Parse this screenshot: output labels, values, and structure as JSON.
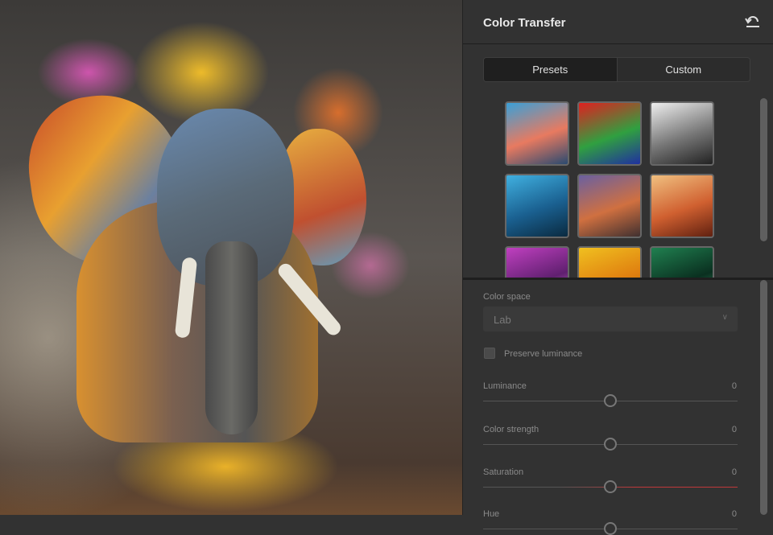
{
  "panel": {
    "title": "Color Transfer",
    "undo_icon": "undo-icon",
    "tabs": [
      {
        "label": "Presets",
        "active": true
      },
      {
        "label": "Custom",
        "active": false
      }
    ],
    "presets": [
      {
        "name": "sunset-sea",
        "colors": [
          "#3aa0d8",
          "#e87a60",
          "#2a4a70"
        ]
      },
      {
        "name": "abstract-paint",
        "colors": [
          "#e02020",
          "#30a040",
          "#2030a0"
        ]
      },
      {
        "name": "cathedral-bw",
        "colors": [
          "#eeeeee",
          "#777777",
          "#222222"
        ]
      },
      {
        "name": "blue-feathers",
        "colors": [
          "#40b0e0",
          "#1a6090",
          "#0a2a40"
        ]
      },
      {
        "name": "desert-road",
        "colors": [
          "#6a60a0",
          "#d07040",
          "#403030"
        ]
      },
      {
        "name": "skateboarder",
        "colors": [
          "#f0c080",
          "#d06030",
          "#602010"
        ]
      },
      {
        "name": "purple-flowers",
        "colors": [
          "#c040c0",
          "#602070",
          "#e080e0"
        ]
      },
      {
        "name": "yellow-flower",
        "colors": [
          "#f0c020",
          "#e08010",
          "#a06000"
        ]
      },
      {
        "name": "green-leaves",
        "colors": [
          "#208050",
          "#0a3020",
          "#40a070"
        ]
      }
    ],
    "color_space": {
      "label": "Color space",
      "value": "Lab"
    },
    "preserve_luminance": {
      "label": "Preserve luminance",
      "checked": false
    },
    "sliders": [
      {
        "label": "Luminance",
        "value": "0",
        "fraction": 0.5
      },
      {
        "label": "Color strength",
        "value": "0",
        "fraction": 0.5
      },
      {
        "label": "Saturation",
        "value": "0",
        "fraction": 0.5
      },
      {
        "label": "Hue",
        "value": "0",
        "fraction": 0.5
      }
    ]
  },
  "colors": {
    "accent_saturation": "#c0393b"
  }
}
